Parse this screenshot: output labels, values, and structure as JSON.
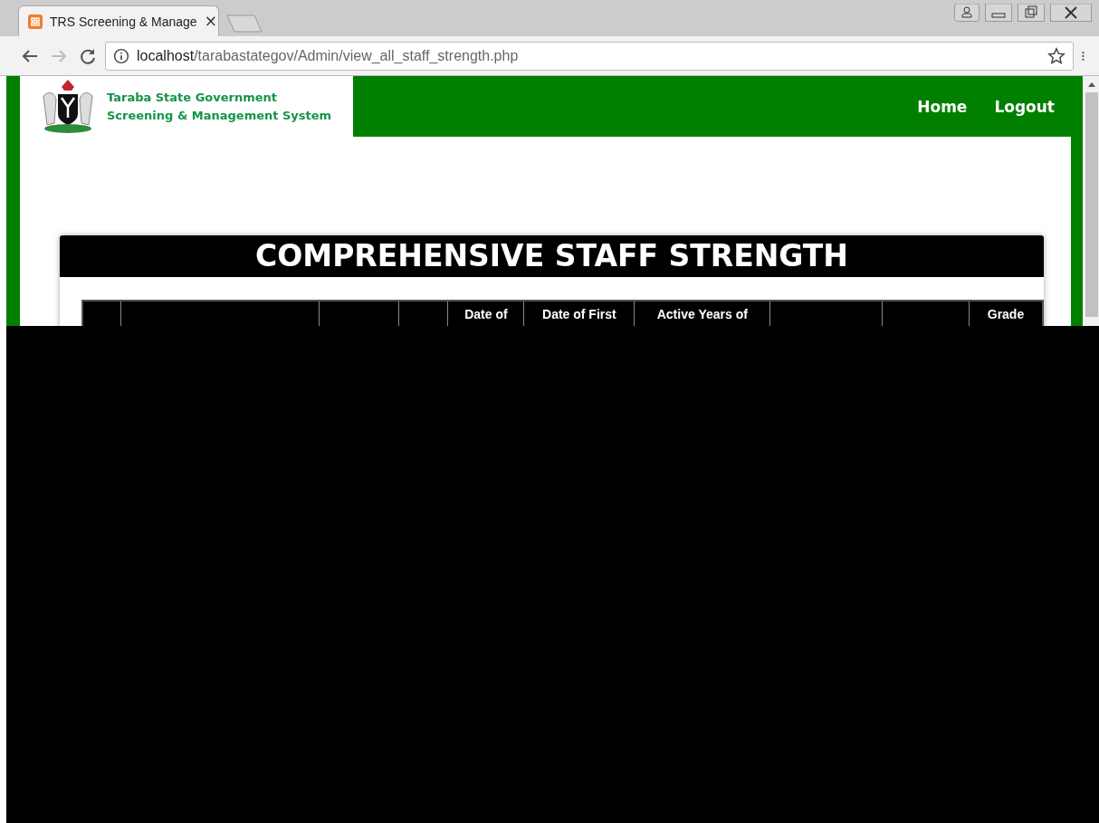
{
  "browser": {
    "tab": {
      "title": "TRS Screening & Manage",
      "close": "×"
    },
    "address": {
      "host": "localhost",
      "path": "/tarabastategov/Admin/view_all_staff_strength.php"
    }
  },
  "header": {
    "title_lines": [
      "Taraba State Government",
      "Screening & Management System"
    ],
    "nav": [
      {
        "label": "Home"
      },
      {
        "label": "Logout"
      }
    ]
  },
  "card": {
    "title": "COMPREHENSIVE STAFF STRENGTH"
  },
  "table": {
    "columns": [
      {
        "kind": "covered"
      },
      {
        "kind": "covered"
      },
      {
        "kind": "covered"
      },
      {
        "kind": "covered"
      },
      {
        "kind": "text",
        "label": "Date of"
      },
      {
        "kind": "text",
        "label": "Date of First"
      },
      {
        "kind": "text",
        "label": "Active Years of"
      },
      {
        "kind": "covered"
      },
      {
        "kind": "covered"
      },
      {
        "kind": "text",
        "label": "Grade"
      }
    ]
  }
}
